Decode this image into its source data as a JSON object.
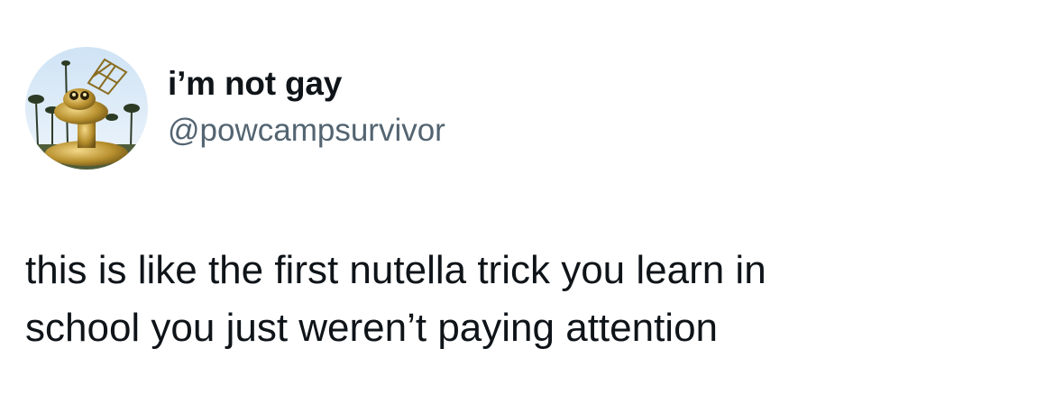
{
  "tweet": {
    "author": {
      "display_name": "i’m not gay",
      "handle": "@powcampsurvivor",
      "avatar_icon": "robot-avatar"
    },
    "text_lines": [
      "this is like the first nutella trick you learn in",
      "school you just weren’t paying attention"
    ]
  },
  "colors": {
    "background": "#ffffff",
    "primary_text": "#0f1419",
    "secondary_text": "#536471"
  }
}
